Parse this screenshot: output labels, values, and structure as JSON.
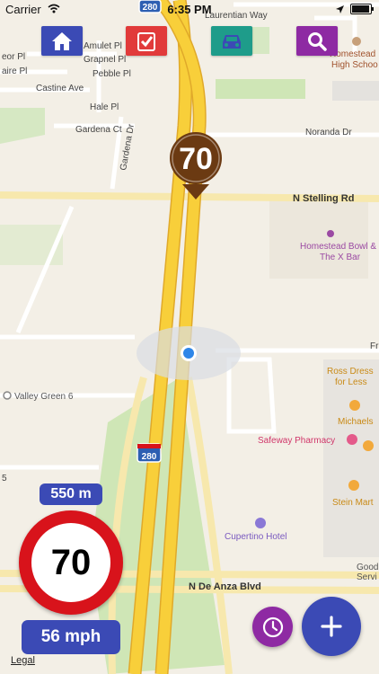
{
  "status_bar": {
    "carrier": "Carrier",
    "time": "6:35 PM",
    "icons": [
      "wifi-icon",
      "location-arrow-icon",
      "battery-icon"
    ]
  },
  "toolbar": {
    "buttons": [
      {
        "name": "home",
        "icon": "house-icon",
        "color": "#3b4ab5"
      },
      {
        "name": "checklist",
        "icon": "check-list-icon",
        "color": "#e13a3a"
      },
      {
        "name": "vehicle",
        "icon": "car-icon",
        "color": "#1e9c8a"
      },
      {
        "name": "search",
        "icon": "search-icon",
        "color": "#8e2aa3"
      }
    ]
  },
  "map": {
    "streets": {
      "laurentian": "Laurentian Way",
      "amulet": "Amulet Pl",
      "grapnel": "Grapnel Pl",
      "pebble": "Pebble Pl",
      "eor": "eor Pl",
      "aire": "aire Pl",
      "castine": "Castine Ave",
      "hale": "Hale Pl",
      "gardena_ct": "Gardena Ct",
      "gardena_dr": "Gardena Dr",
      "noranda": "Noranda Dr",
      "stelling": "N Stelling Rd",
      "de_anza": "N De Anza Blvd",
      "five": "5",
      "fr": "Fr"
    },
    "pois": {
      "homestead_high_1": "Homestead",
      "homestead_high_2": "High Schoo",
      "bowl_1": "Homestead Bowl &",
      "bowl_2": "The X Bar",
      "valley_green": "Valley Green 6",
      "ross_1": "Ross Dress",
      "ross_2": "for Less",
      "michaels": "Michaels",
      "safeway": "Safeway Pharmacy",
      "stein": "Stein Mart",
      "cupertino_hotel": "Cupertino Hotel",
      "good_1": "Good",
      "good_2": "Servi"
    },
    "highway_shield": "280",
    "camera_marker_speed": "70",
    "colors": {
      "highway": "#f8cf3a",
      "highway_edge": "#e0a92a",
      "poi_purple": "#9b4aa3",
      "poi_orange": "#c98a16",
      "marker_brown": "#6b3a12",
      "location_blue": "#2e86e8"
    }
  },
  "overlay": {
    "distance": "550 m",
    "speed_limit": "70",
    "current_speed": "56 mph",
    "history_icon": "clock-icon",
    "add_icon": "plus-icon",
    "legal": "Legal"
  }
}
